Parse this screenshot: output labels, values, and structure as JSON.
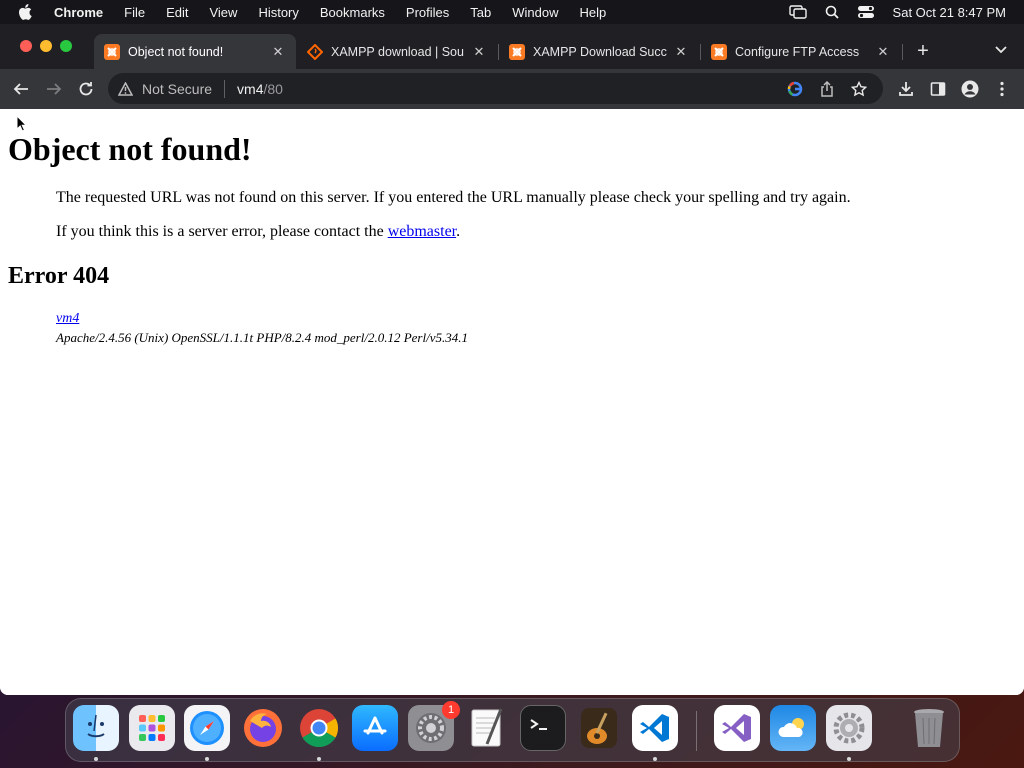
{
  "menubar": {
    "app_name": "Chrome",
    "items": [
      "File",
      "Edit",
      "View",
      "History",
      "Bookmarks",
      "Profiles",
      "Tab",
      "Window",
      "Help"
    ],
    "clock": "Sat Oct 21  8:47 PM"
  },
  "tabs": [
    {
      "title": "Object not found!",
      "favicon": "xampp-icon",
      "active": true
    },
    {
      "title": "XAMPP download | Sou",
      "favicon": "sourceforge-icon",
      "active": false
    },
    {
      "title": "XAMPP Download Succ",
      "favicon": "xampp-icon",
      "active": false
    },
    {
      "title": "Configure FTP Access",
      "favicon": "xampp-icon",
      "active": false
    }
  ],
  "omnibox": {
    "security_label": "Not Secure",
    "host": "vm4",
    "path": "/80"
  },
  "page": {
    "heading": "Object not found!",
    "p1": "The requested URL was not found on this server. If you entered the URL manually please check your spelling and try again.",
    "p2_prefix": "If you think this is a server error, please contact the ",
    "p2_link": "webmaster",
    "p2_suffix": ".",
    "error_heading": "Error 404",
    "address_host": "vm4",
    "address_server": "Apache/2.4.56 (Unix) OpenSSL/1.1.1t PHP/8.2.4 mod_perl/2.0.12 Perl/v5.34.1"
  },
  "dock": {
    "apps": [
      "finder-icon",
      "launchpad-icon",
      "safari-icon",
      "firefox-icon",
      "chrome-icon",
      "app-store-icon",
      "system-settings-icon",
      "textedit-icon",
      "terminal-icon",
      "garageband-icon",
      "vscode-icon",
      "visual-studio-icon",
      "weather-icon",
      "settings-gear-icon",
      "trash-icon"
    ],
    "settings_badge": "1"
  },
  "colors": {
    "tab_active": "#35363a",
    "tabstrip": "#1f1f24",
    "link": "#0000ee",
    "badge": "#ff3b30"
  }
}
